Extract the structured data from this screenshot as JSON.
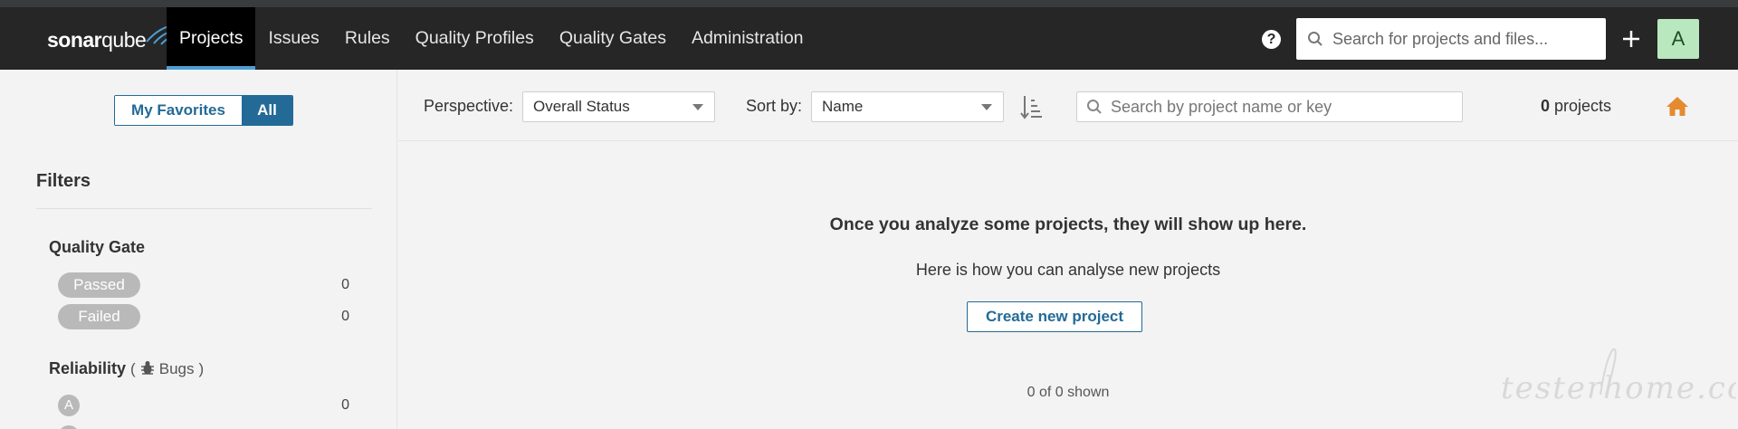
{
  "navbar": {
    "logo": {
      "left": "sonar",
      "right": "qube"
    },
    "items": [
      {
        "label": "Projects",
        "active": true
      },
      {
        "label": "Issues"
      },
      {
        "label": "Rules"
      },
      {
        "label": "Quality Profiles"
      },
      {
        "label": "Quality Gates"
      },
      {
        "label": "Administration"
      }
    ],
    "help_icon": "?",
    "search_placeholder": "Search for projects and files...",
    "plus_icon": "plus-icon",
    "avatar_letter": "A"
  },
  "sidebar": {
    "toggle": {
      "favorites": "My Favorites",
      "all": "All"
    },
    "filters_title": "Filters",
    "quality_gate": {
      "title": "Quality Gate",
      "options": [
        {
          "label": "Passed",
          "count": "0"
        },
        {
          "label": "Failed",
          "count": "0"
        }
      ]
    },
    "reliability": {
      "title": "Reliability",
      "paren_open": "(",
      "sub": "Bugs",
      "paren_close": ")",
      "options": [
        {
          "label": "A",
          "count": "0"
        }
      ]
    }
  },
  "toolbar": {
    "perspective_label": "Perspective:",
    "perspective_value": "Overall Status",
    "sortby_label": "Sort by:",
    "sortby_value": "Name",
    "search_placeholder": "Search by project name or key",
    "count_number": "0",
    "count_text": "projects"
  },
  "main": {
    "empty_title": "Once you analyze some projects, they will show up here.",
    "empty_sub": "Here is how you can analyse new projects",
    "create_button": "Create new project",
    "shown": "0 of 0 shown"
  },
  "watermark": "testerhome.com",
  "colors": {
    "brand": "#236a97",
    "navbar": "#262626",
    "accent": "#4b9fd5",
    "home": "#e58a2e",
    "avatar": "#b9e8bf"
  }
}
